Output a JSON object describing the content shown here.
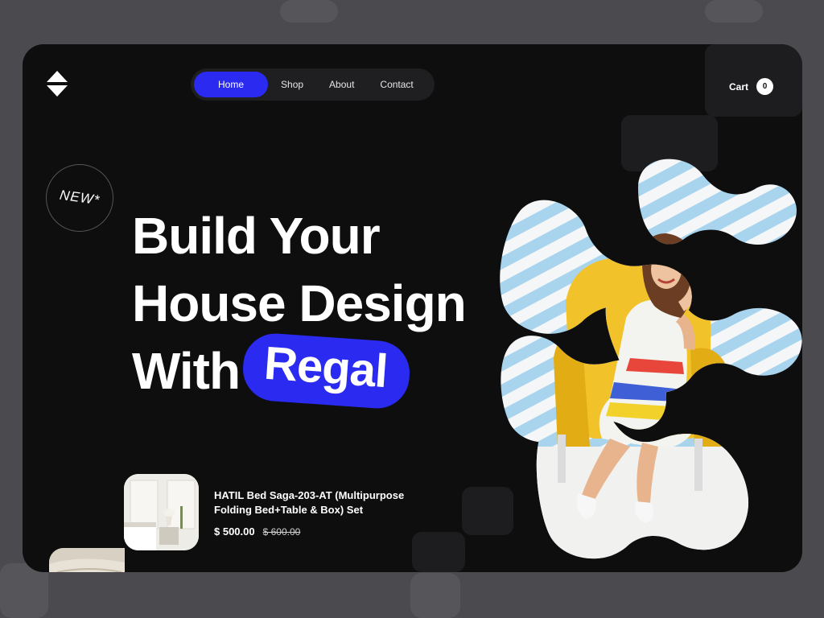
{
  "nav": {
    "items": [
      {
        "label": "Home",
        "active": true
      },
      {
        "label": "Shop",
        "active": false
      },
      {
        "label": "About",
        "active": false
      },
      {
        "label": "Contact",
        "active": false
      }
    ]
  },
  "cart": {
    "label": "Cart",
    "count": "0"
  },
  "badge": {
    "label": "NEW*"
  },
  "hero": {
    "line1": "Build Your",
    "line2": "House Design",
    "line3": "With",
    "highlight": "Regal"
  },
  "product": {
    "title": "HATIL Bed Saga-203-AT (Multipurpose Folding Bed+Table & Box) Set",
    "price": "$ 500.00",
    "old_price": "$ 600.00"
  },
  "colors": {
    "accent": "#2a2af0",
    "background": "#0e0e0f",
    "outer": "#4a4a4f",
    "stripe": "#a8d4ee",
    "chair": "#f2c22a"
  }
}
